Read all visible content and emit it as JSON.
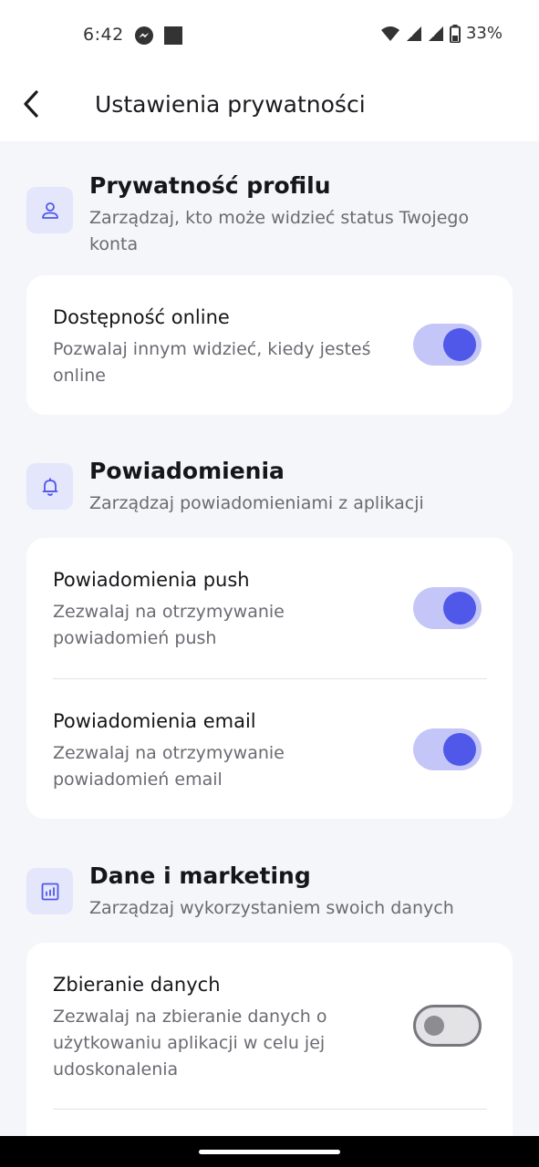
{
  "status_bar": {
    "time": "6:42",
    "battery": "33%"
  },
  "header": {
    "title": "Ustawienia prywatności"
  },
  "sections": [
    {
      "title": "Prywatność profilu",
      "subtitle": "Zarządzaj, kto może widzieć status Twojego konta",
      "icon": "person-icon",
      "items": [
        {
          "title": "Dostępność online",
          "subtitle": "Pozwalaj innym widzieć, kiedy jesteś online",
          "enabled": true
        }
      ]
    },
    {
      "title": "Powiadomienia",
      "subtitle": "Zarządzaj powiadomieniami z aplikacji",
      "icon": "bell-icon",
      "items": [
        {
          "title": "Powiadomienia push",
          "subtitle": "Zezwalaj na otrzymywanie powiadomień push",
          "enabled": true
        },
        {
          "title": "Powiadomienia email",
          "subtitle": "Zezwalaj na otrzymywanie powiadomień email",
          "enabled": true
        }
      ]
    },
    {
      "title": "Dane i marketing",
      "subtitle": "Zarządzaj wykorzystaniem swoich danych",
      "icon": "chart-icon",
      "items": [
        {
          "title": "Zbieranie danych",
          "subtitle": "Zezwalaj na zbieranie danych o użytkowaniu aplikacji w celu jej udoskonalenia",
          "enabled": false
        }
      ]
    }
  ],
  "colors": {
    "accent": "#4f58e8",
    "accent_track": "#c3c6f7",
    "icon_bg": "#e4e6fb",
    "background": "#f5f6fa"
  }
}
